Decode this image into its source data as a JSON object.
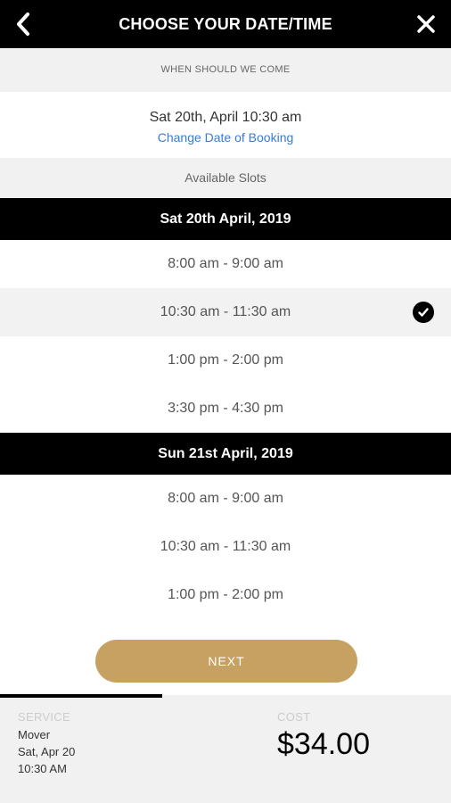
{
  "header": {
    "title": "CHOOSE YOUR DATE/TIME",
    "back_icon": "chevron-left-icon",
    "close_icon": "close-icon"
  },
  "when": {
    "label": "WHEN SHOULD WE COME"
  },
  "booking": {
    "datetime": "Sat 20th, April 10:30 am",
    "change_link": "Change Date of Booking"
  },
  "available": {
    "label": "Available Slots"
  },
  "days": [
    {
      "title": "Sat 20th April, 2019",
      "slots": [
        "8:00 am - 9:00 am",
        "10:30 am - 11:30 am",
        "1:00 pm - 2:00 pm",
        "3:30 pm - 4:30 pm"
      ]
    },
    {
      "title": "Sun 21st April, 2019",
      "slots": [
        "8:00 am - 9:00 am",
        "10:30 am - 11:30 am",
        "1:00 pm - 2:00 pm"
      ]
    }
  ],
  "selected_slot": "10:30 am - 11:30 am",
  "next_button": "NEXT",
  "footer": {
    "service_label": "SERVICE",
    "service_name": "Mover",
    "service_date": "Sat, Apr 20",
    "service_time": "10:30 AM",
    "cost_label": "COST",
    "price": "$34.00"
  },
  "colors": {
    "accent": "#c6a161",
    "header_bg": "#000000",
    "link": "#3a7bd5",
    "panel_bg": "#f1f1f1"
  }
}
